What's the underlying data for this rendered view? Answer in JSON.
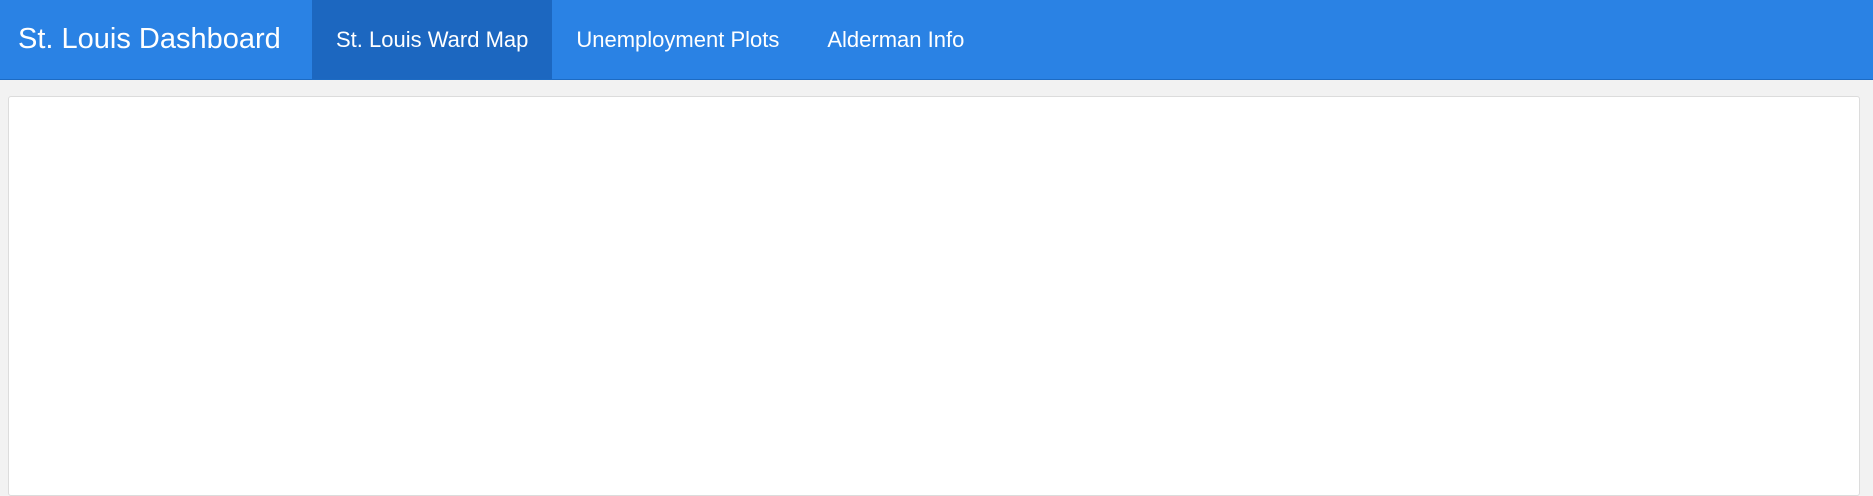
{
  "app": {
    "title": "St. Louis Dashboard"
  },
  "nav": {
    "tabs": [
      {
        "label": "St. Louis Ward Map",
        "active": true
      },
      {
        "label": "Unemployment Plots",
        "active": false
      },
      {
        "label": "Alderman Info",
        "active": false
      }
    ]
  },
  "colors": {
    "navbar": "#2a82e4",
    "active_tab": "#1c67c0",
    "page_background": "#f2f2f2",
    "panel_background": "#ffffff"
  }
}
